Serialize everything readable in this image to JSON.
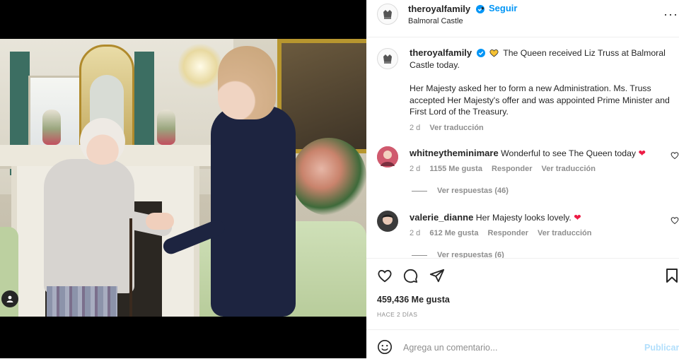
{
  "post": {
    "author": "theroyalfamily",
    "follow_label": "Seguir",
    "separator": "•",
    "location": "Balmoral Castle",
    "more_label": "···"
  },
  "caption": {
    "username": "theroyalfamily",
    "text_line1": "The Queen received Liz Truss at Balmoral Castle today.",
    "text_line2": "Her Majesty asked her to form a new Administration. Ms. Truss accepted Her Majesty's offer and was appointed Prime Minister and First Lord of the Treasury.",
    "time": "2 d",
    "translate": "Ver traducción"
  },
  "comments": [
    {
      "username": "whitneytheminimare",
      "text": "Wonderful to see The Queen today",
      "time": "2 d",
      "likes": "1155 Me gusta",
      "reply": "Responder",
      "translate": "Ver traducción",
      "replies": "Ver respuestas (46)"
    },
    {
      "username": "valerie_dianne",
      "text": "Her Majesty looks lovely.",
      "time": "2 d",
      "likes": "612 Me gusta",
      "reply": "Responder",
      "translate": "Ver traducción",
      "replies": "Ver respuestas (6)"
    }
  ],
  "stats": {
    "likes": "459,436 Me gusta",
    "time_ago": "HACE 2 DÍAS"
  },
  "composer": {
    "placeholder": "Agrega un comentario...",
    "publish_label": "Publicar"
  },
  "colors": {
    "accent": "#0095f6",
    "heart": "#ed1b45",
    "muted": "#8e8e8e"
  }
}
